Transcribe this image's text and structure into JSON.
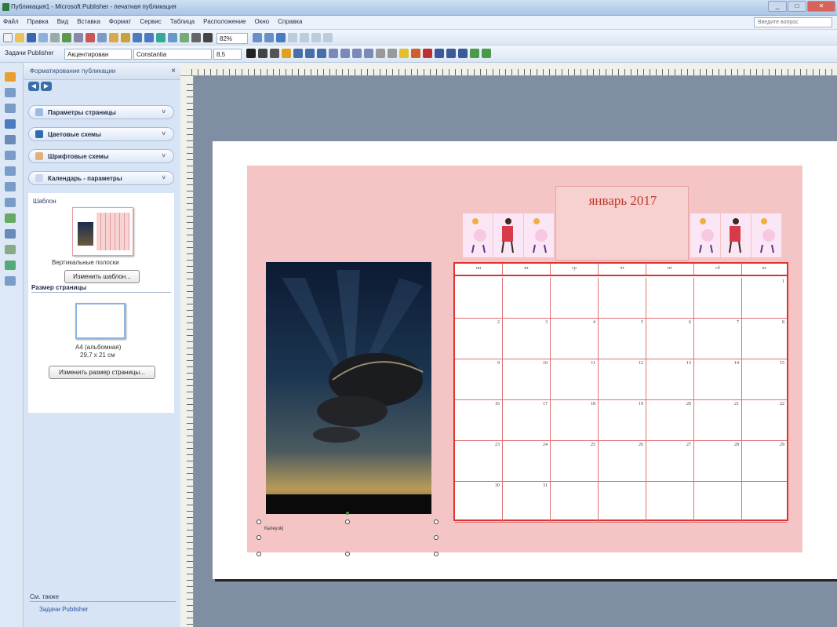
{
  "window": {
    "title": "Публикация1 - Microsoft Publisher - печатная публикация",
    "buttons": [
      "_",
      "□",
      "✕"
    ]
  },
  "menu": {
    "items": [
      "Файл",
      "Правка",
      "Вид",
      "Вставка",
      "Формат",
      "Сервис",
      "Таблица",
      "Расположение",
      "Окно",
      "Справка"
    ],
    "help_placeholder": "Введите вопрос"
  },
  "toolbar2": {
    "tasks": "Задачи Publisher",
    "style": "Акцентирован",
    "font": "Constantia",
    "size": "8,5",
    "zoom": "82%"
  },
  "pane": {
    "title": "Форматирование публикации",
    "close": "×",
    "sections": [
      {
        "label": "Параметры страницы",
        "color": "#9bbbe0"
      },
      {
        "label": "Цветовые схемы",
        "color": "#2f6db3"
      },
      {
        "label": "Шрифтовые схемы",
        "color": "#e0b07a"
      },
      {
        "label": "Календарь - параметры",
        "color": "#c9d8ec"
      }
    ],
    "templates_label": "Шаблон",
    "template_name": "Вертикальные полоски",
    "change_template": "Изменить шаблон...",
    "page_size_label": "Размер страницы",
    "page_size_name": "A4 (альбомная)",
    "page_size_dims": "29,7 x 21 см",
    "change_page_size": "Изменить размер страницы...",
    "see_also": "См. также",
    "see_also_link": "Задачи Publisher"
  },
  "calendar": {
    "month": "январь 2017",
    "weekdays": [
      "пн",
      "вт",
      "ср",
      "чт",
      "пт",
      "сб",
      "вс"
    ],
    "weeks": [
      [
        "",
        "",
        "",
        "",
        "",
        "",
        "1"
      ],
      [
        "2",
        "3",
        "4",
        "5",
        "6",
        "7",
        "8"
      ],
      [
        "9",
        "10",
        "11",
        "12",
        "13",
        "14",
        "15"
      ],
      [
        "16",
        "17",
        "18",
        "19",
        "20",
        "21",
        "22"
      ],
      [
        "23",
        "24",
        "25",
        "26",
        "27",
        "28",
        "29"
      ],
      [
        "30",
        "31",
        "",
        "",
        "",
        "",
        ""
      ]
    ],
    "caption": "Калеyuk|"
  },
  "colors": {
    "accent": "#c0392b",
    "pink": "#f5c4c4",
    "grid": "#d33"
  }
}
